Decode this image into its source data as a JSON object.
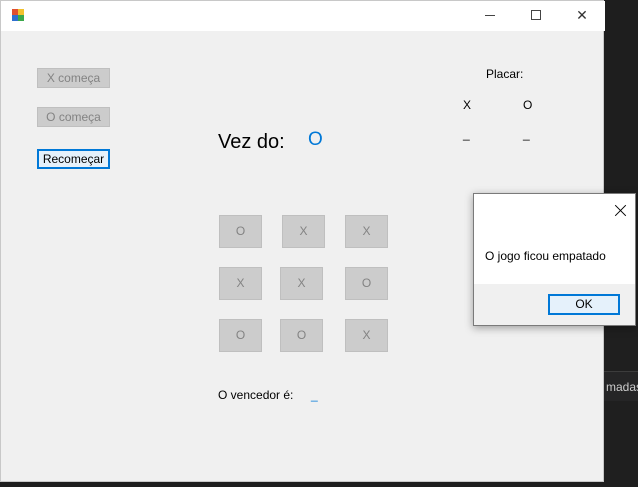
{
  "window": {
    "title": "",
    "controls": {
      "minimize": "",
      "maximize": "",
      "close": "✕"
    }
  },
  "buttons": {
    "x_starts": "X começa",
    "o_starts": "O começa",
    "restart": "Recomeçar"
  },
  "turn": {
    "label": "Vez do:",
    "value": "O"
  },
  "score": {
    "title": "Placar:",
    "x_label": "X",
    "o_label": "O",
    "x_value": "_",
    "o_value": "_"
  },
  "board": [
    "O",
    "X",
    "X",
    "X",
    "X",
    "O",
    "O",
    "O",
    "X"
  ],
  "winner": {
    "label": "O vencedor é:",
    "value": "_"
  },
  "dialog": {
    "message": "O jogo ficou empatado",
    "ok": "OK"
  },
  "background": {
    "tab_text": "madas"
  },
  "colors": {
    "accent": "#0078d7",
    "disabled_bg": "#cccccc",
    "disabled_text": "#838383"
  }
}
